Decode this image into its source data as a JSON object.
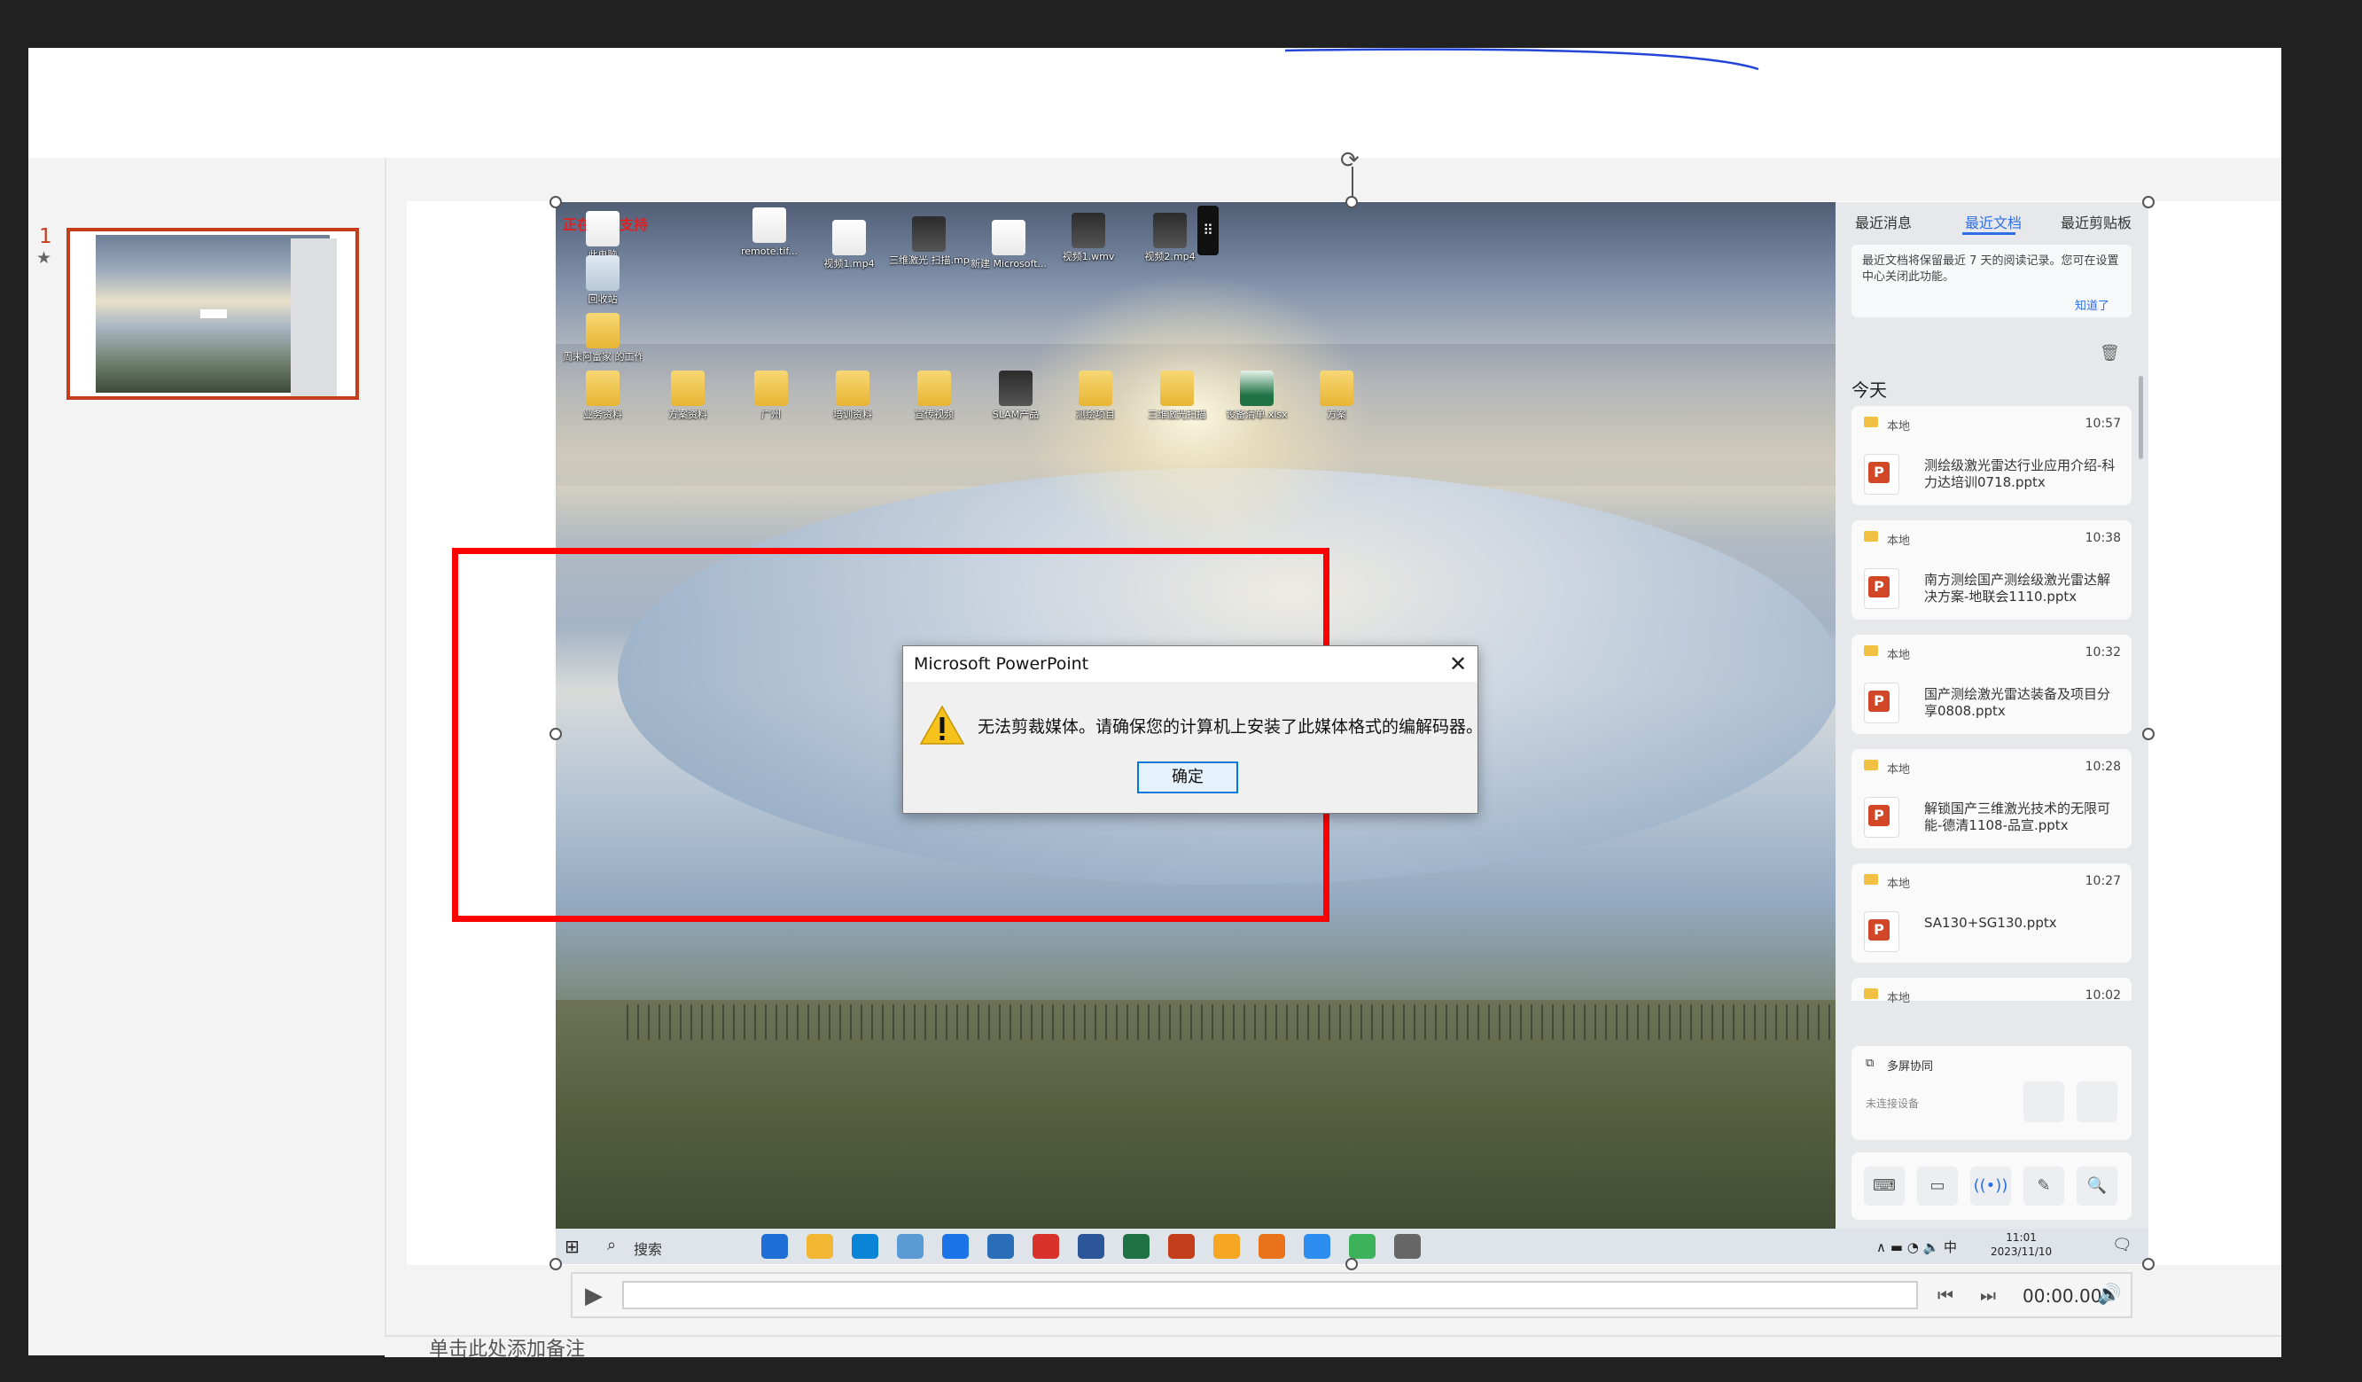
{
  "slide_panel": {
    "slide_number": "1",
    "star": "★"
  },
  "notes": {
    "placeholder": "单击此处添加备注"
  },
  "desktop": {
    "remote_label": "正在远程支持",
    "drag_handle": "⠿",
    "icons": [
      {
        "label": "此电脑",
        "kind": "doc"
      },
      {
        "label": "回收站",
        "kind": "recycle"
      },
      {
        "label": "周末阿富家 的工作 - 快...",
        "kind": "folder"
      },
      {
        "label": "remote.tif...",
        "kind": "doc"
      },
      {
        "label": "视频1.mp4",
        "kind": "doc"
      },
      {
        "label": "三维激光 扫描.mp4",
        "kind": "video"
      },
      {
        "label": "新建 Microsoft...",
        "kind": "doc"
      },
      {
        "label": "视频1.wmv",
        "kind": "video"
      },
      {
        "label": "视频2.mp4",
        "kind": "video"
      },
      {
        "label": "业务资料",
        "kind": "folder"
      },
      {
        "label": "方案资料",
        "kind": "folder"
      },
      {
        "label": "广州",
        "kind": "folder"
      },
      {
        "label": "培训资料",
        "kind": "folder"
      },
      {
        "label": "宣传视频",
        "kind": "folder"
      },
      {
        "label": "SLAM产品",
        "kind": "video"
      },
      {
        "label": "测绘项目",
        "kind": "folder"
      },
      {
        "label": "三维激光扫描",
        "kind": "folder"
      },
      {
        "label": "设备清单.xlsx",
        "kind": "xls"
      },
      {
        "label": "方案",
        "kind": "folder"
      }
    ]
  },
  "dialog": {
    "title": "Microsoft PowerPoint",
    "close": "✕",
    "message": "无法剪裁媒体。请确保您的计算机上安装了此媒体格式的编解码器。",
    "ok_label": "确定"
  },
  "side_panel": {
    "tabs": [
      "最近消息",
      "最近文档",
      "最近剪贴板"
    ],
    "active_tab": "最近文档",
    "notice": "最近文档将保留最近 7 天的阅读记录。您可在设置中心关闭此功能。",
    "notice_link": "知道了",
    "trash_icon": "🗑",
    "section": "今天",
    "docs": [
      {
        "source": "本地",
        "time": "10:57",
        "name": "测绘级激光雷达行业应用介绍-科力达培训0718.pptx"
      },
      {
        "source": "本地",
        "time": "10:38",
        "name": "南方测绘国产测绘级激光雷达解决方案-地联会1110.pptx"
      },
      {
        "source": "本地",
        "time": "10:32",
        "name": "国产测绘激光雷达装备及项目分享0808.pptx"
      },
      {
        "source": "本地",
        "time": "10:28",
        "name": "解锁国产三维激光技术的无限可能-德清1108-品宣.pptx"
      },
      {
        "source": "本地",
        "time": "10:27",
        "name": "SA130+SG130.pptx"
      },
      {
        "source": "本地",
        "time": "10:02",
        "name": ""
      }
    ],
    "multi_screen": {
      "title": "多屏协同",
      "subtitle": "未连接设备"
    },
    "tools": [
      "⌨",
      "▭",
      "((•))",
      "✎",
      "🔍"
    ]
  },
  "taskbar": {
    "start": "⊞",
    "search_icon": "⌕",
    "search_text": "搜索",
    "tray": "∧ ▬ ◔ 🔈 中",
    "time": "11:01",
    "date": "2023/11/10",
    "notification_icon": "🗨",
    "app_colors": [
      "#1f6fd6",
      "#f2b632",
      "#0a84d6",
      "#5b9bd5",
      "#1a73e8",
      "#2a6db8",
      "#d9322b",
      "#2b579a",
      "#1f7244",
      "#c43e1c",
      "#f5a623",
      "#e8731a",
      "#2d8cf0",
      "#3cb35a",
      "#666666"
    ]
  },
  "media": {
    "play": "▶",
    "back": "⏮",
    "forward": "⏭",
    "time": "00:00.00",
    "volume": "🔊"
  },
  "colors": {
    "accent": "#c43e1c",
    "annotation": "#ff0000",
    "link": "#2f6fe6"
  }
}
